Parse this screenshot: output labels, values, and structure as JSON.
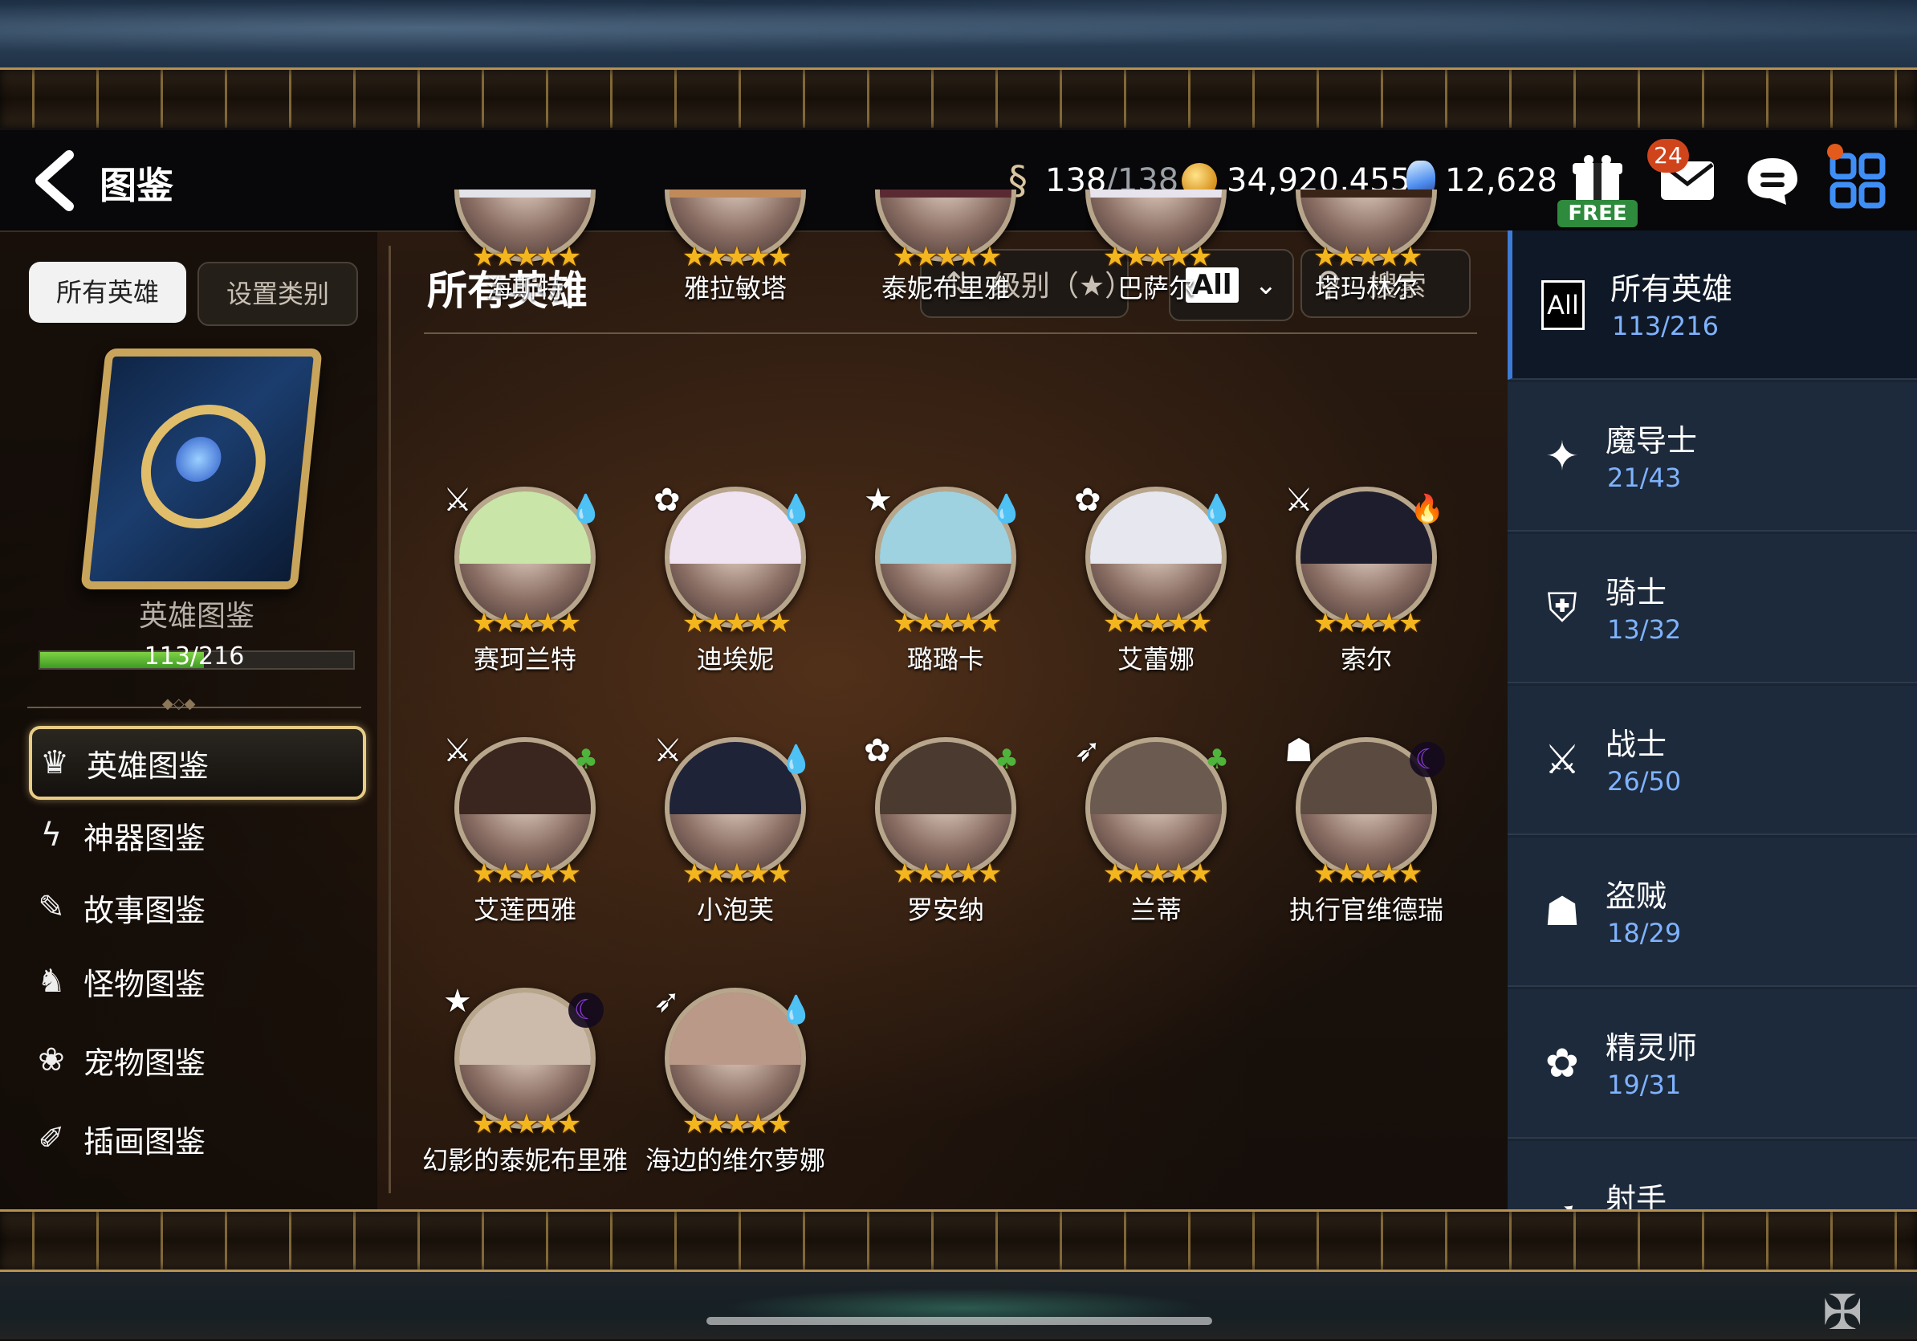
{
  "header": {
    "title": "图鉴",
    "stamina": {
      "current": "138",
      "max": "/138"
    },
    "gold": "34,920,455",
    "crystal": "12,628",
    "free_label": "FREE",
    "mail_badge": "24"
  },
  "left": {
    "tabs": [
      "所有英雄",
      "设置类别"
    ],
    "book_title": "英雄图鉴",
    "progress_text": "113/216",
    "progress_fraction": 0.523,
    "nav": [
      {
        "label": "英雄图鉴",
        "icon": "hero-icon"
      },
      {
        "label": "神器图鉴",
        "icon": "artifact-icon"
      },
      {
        "label": "故事图鉴",
        "icon": "story-icon"
      },
      {
        "label": "怪物图鉴",
        "icon": "monster-icon"
      },
      {
        "label": "宠物图鉴",
        "icon": "pet-icon"
      },
      {
        "label": "插画图鉴",
        "icon": "illustration-icon"
      }
    ]
  },
  "grid": {
    "title": "所有英雄",
    "sort_label": "级别（★）",
    "filter_label": "All",
    "search_label": "搜索",
    "heroes": [
      {
        "name": "海斯特",
        "stars": "★★★★★"
      },
      {
        "name": "雅拉敏塔",
        "stars": "★★★★★"
      },
      {
        "name": "泰妮布里雅",
        "stars": "★★★★★"
      },
      {
        "name": "巴萨尔",
        "stars": "★★★★★"
      },
      {
        "name": "塔玛林尔",
        "stars": "★★★★★"
      },
      {
        "name": "赛珂兰特",
        "stars": "★★★★★",
        "class": "warrior",
        "element": "ice"
      },
      {
        "name": "迪埃妮",
        "stars": "★★★★★",
        "class": "soul-weaver",
        "element": "ice"
      },
      {
        "name": "璐璐卡",
        "stars": "★★★★★",
        "class": "mage",
        "element": "ice"
      },
      {
        "name": "艾蕾娜",
        "stars": "★★★★★",
        "class": "soul-weaver",
        "element": "ice"
      },
      {
        "name": "索尔",
        "stars": "★★★★★",
        "class": "warrior",
        "element": "fire"
      },
      {
        "name": "艾莲西雅",
        "stars": "★★★★★",
        "class": "warrior",
        "element": "earth"
      },
      {
        "name": "小泡芙",
        "stars": "★★★★★",
        "class": "warrior",
        "element": "ice"
      },
      {
        "name": "罗安纳",
        "stars": "★★★★★",
        "class": "soul-weaver",
        "element": "earth"
      },
      {
        "name": "兰蒂",
        "stars": "★★★★★",
        "class": "ranger",
        "element": "earth"
      },
      {
        "name": "执行官维德瑞",
        "stars": "★★★★★",
        "class": "thief",
        "element": "dark"
      },
      {
        "name": "幻影的泰妮布里雅",
        "stars": "★★★★★",
        "class": "mage",
        "element": "dark"
      },
      {
        "name": "海边的维尔萝娜",
        "stars": "★★★★★",
        "class": "ranger",
        "element": "ice"
      }
    ]
  },
  "categories": [
    {
      "name": "所有英雄",
      "count": "113/216",
      "icon": "all-icon",
      "icon_text": "All"
    },
    {
      "name": "魔导士",
      "count": "21/43",
      "icon": "mage-icon"
    },
    {
      "name": "骑士",
      "count": "13/32",
      "icon": "knight-icon"
    },
    {
      "name": "战士",
      "count": "26/50",
      "icon": "warrior-icon"
    },
    {
      "name": "盗贼",
      "count": "18/29",
      "icon": "thief-icon"
    },
    {
      "name": "精灵师",
      "count": "19/31",
      "icon": "soul-weaver-icon"
    },
    {
      "name": "射手",
      "count": "",
      "icon": "ranger-icon"
    }
  ],
  "colors": {
    "accent_gold": "#e7cc85",
    "progress_green": "#7fd145",
    "count_blue": "#7fb3ff",
    "ice": "#3a9ff0",
    "fire": "#e24a23",
    "earth": "#4fb43c",
    "dark": "#8a3ad6"
  }
}
